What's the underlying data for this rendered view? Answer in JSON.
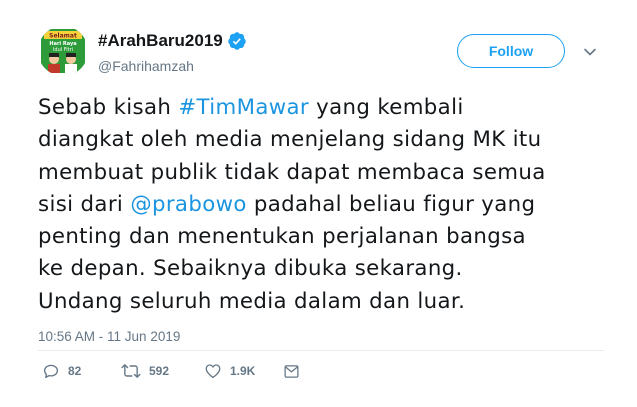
{
  "tweet": {
    "display_name": "#ArahBaru2019",
    "handle": "@Fahrihamzah",
    "follow_label": "Follow",
    "text_lines": [
      [
        {
          "t": "Sebab kisah "
        },
        {
          "t": "#TimMawar",
          "link": true
        },
        {
          "t": " yang kembali"
        }
      ],
      [
        {
          "t": "diangkat oleh media menjelang sidang MK itu"
        }
      ],
      [
        {
          "t": "membuat publik tidak dapat membaca semua"
        }
      ],
      [
        {
          "t": "sisi dari "
        },
        {
          "t": "@prabowo",
          "link": true
        },
        {
          "t": " padahal beliau figur yang"
        }
      ],
      [
        {
          "t": "penting dan menentukan perjalanan bangsa"
        }
      ],
      [
        {
          "t": "ke depan. Sebaiknya dibuka sekarang."
        }
      ],
      [
        {
          "t": "Undang seluruh media dalam dan luar."
        }
      ]
    ],
    "timestamp": "10:56 AM - 11 Jun 2019",
    "actions": {
      "reply_count": "82",
      "retweet_count": "592",
      "like_count": "1.9K"
    }
  },
  "avatar_text": [
    "Selamat",
    "Hari Raya",
    "Idul Fitri"
  ],
  "colors": {
    "link": "#1b95e0",
    "follow": "#1da1f2",
    "secondary": "#657786",
    "avatar_bg": "#2e9b3a"
  },
  "icons": {
    "verified": "verified-badge-icon",
    "caret": "chevron-down-icon",
    "reply": "reply-icon",
    "retweet": "retweet-icon",
    "like": "heart-icon",
    "dm": "envelope-icon"
  }
}
